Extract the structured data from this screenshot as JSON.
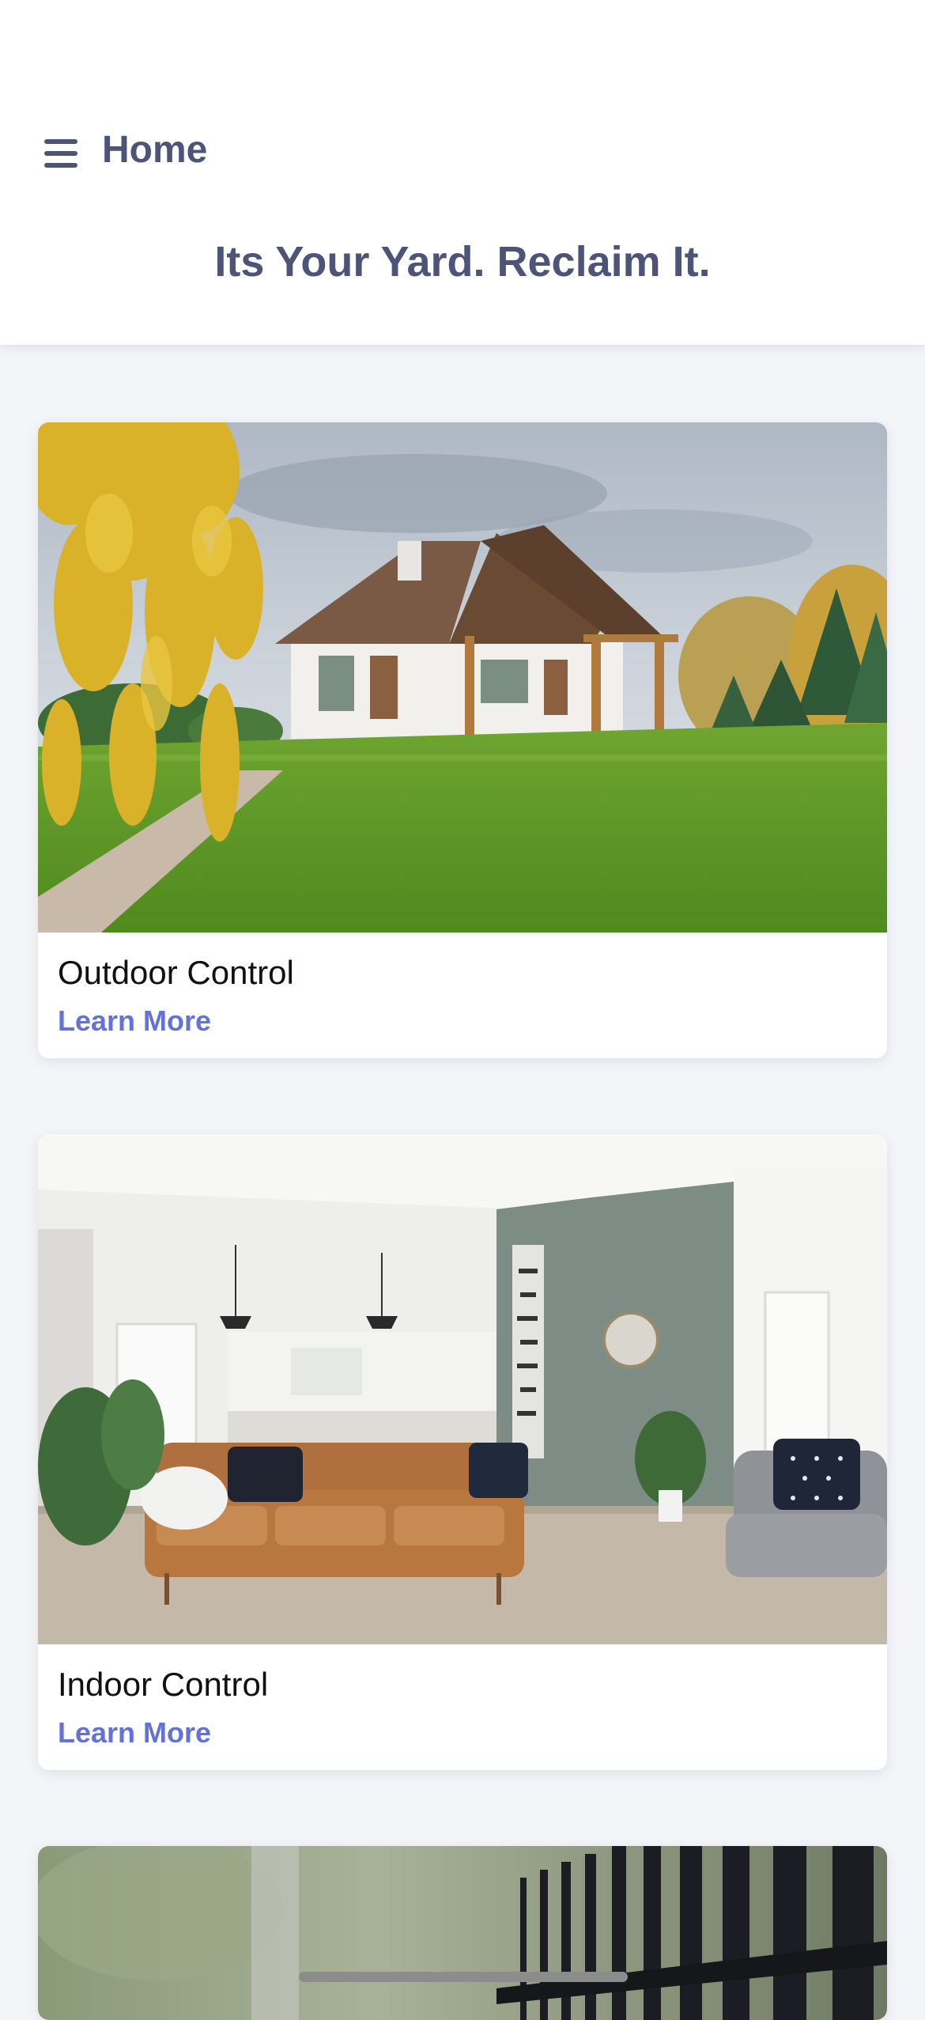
{
  "header": {
    "menu_icon": "hamburger-menu-icon",
    "title": "Home",
    "tagline": "Its Your Yard. Reclaim It."
  },
  "cards": [
    {
      "title": "Outdoor Control",
      "link": "Learn More",
      "image": "house-with-lawn-photo"
    },
    {
      "title": "Indoor Control",
      "link": "Learn More",
      "image": "living-room-with-sofa-photo"
    },
    {
      "title": "",
      "link": "",
      "image": "black-fence-photo"
    }
  ],
  "colors": {
    "header_text": "#4c5578",
    "link": "#6272d9",
    "background": "#f3f5f9"
  }
}
